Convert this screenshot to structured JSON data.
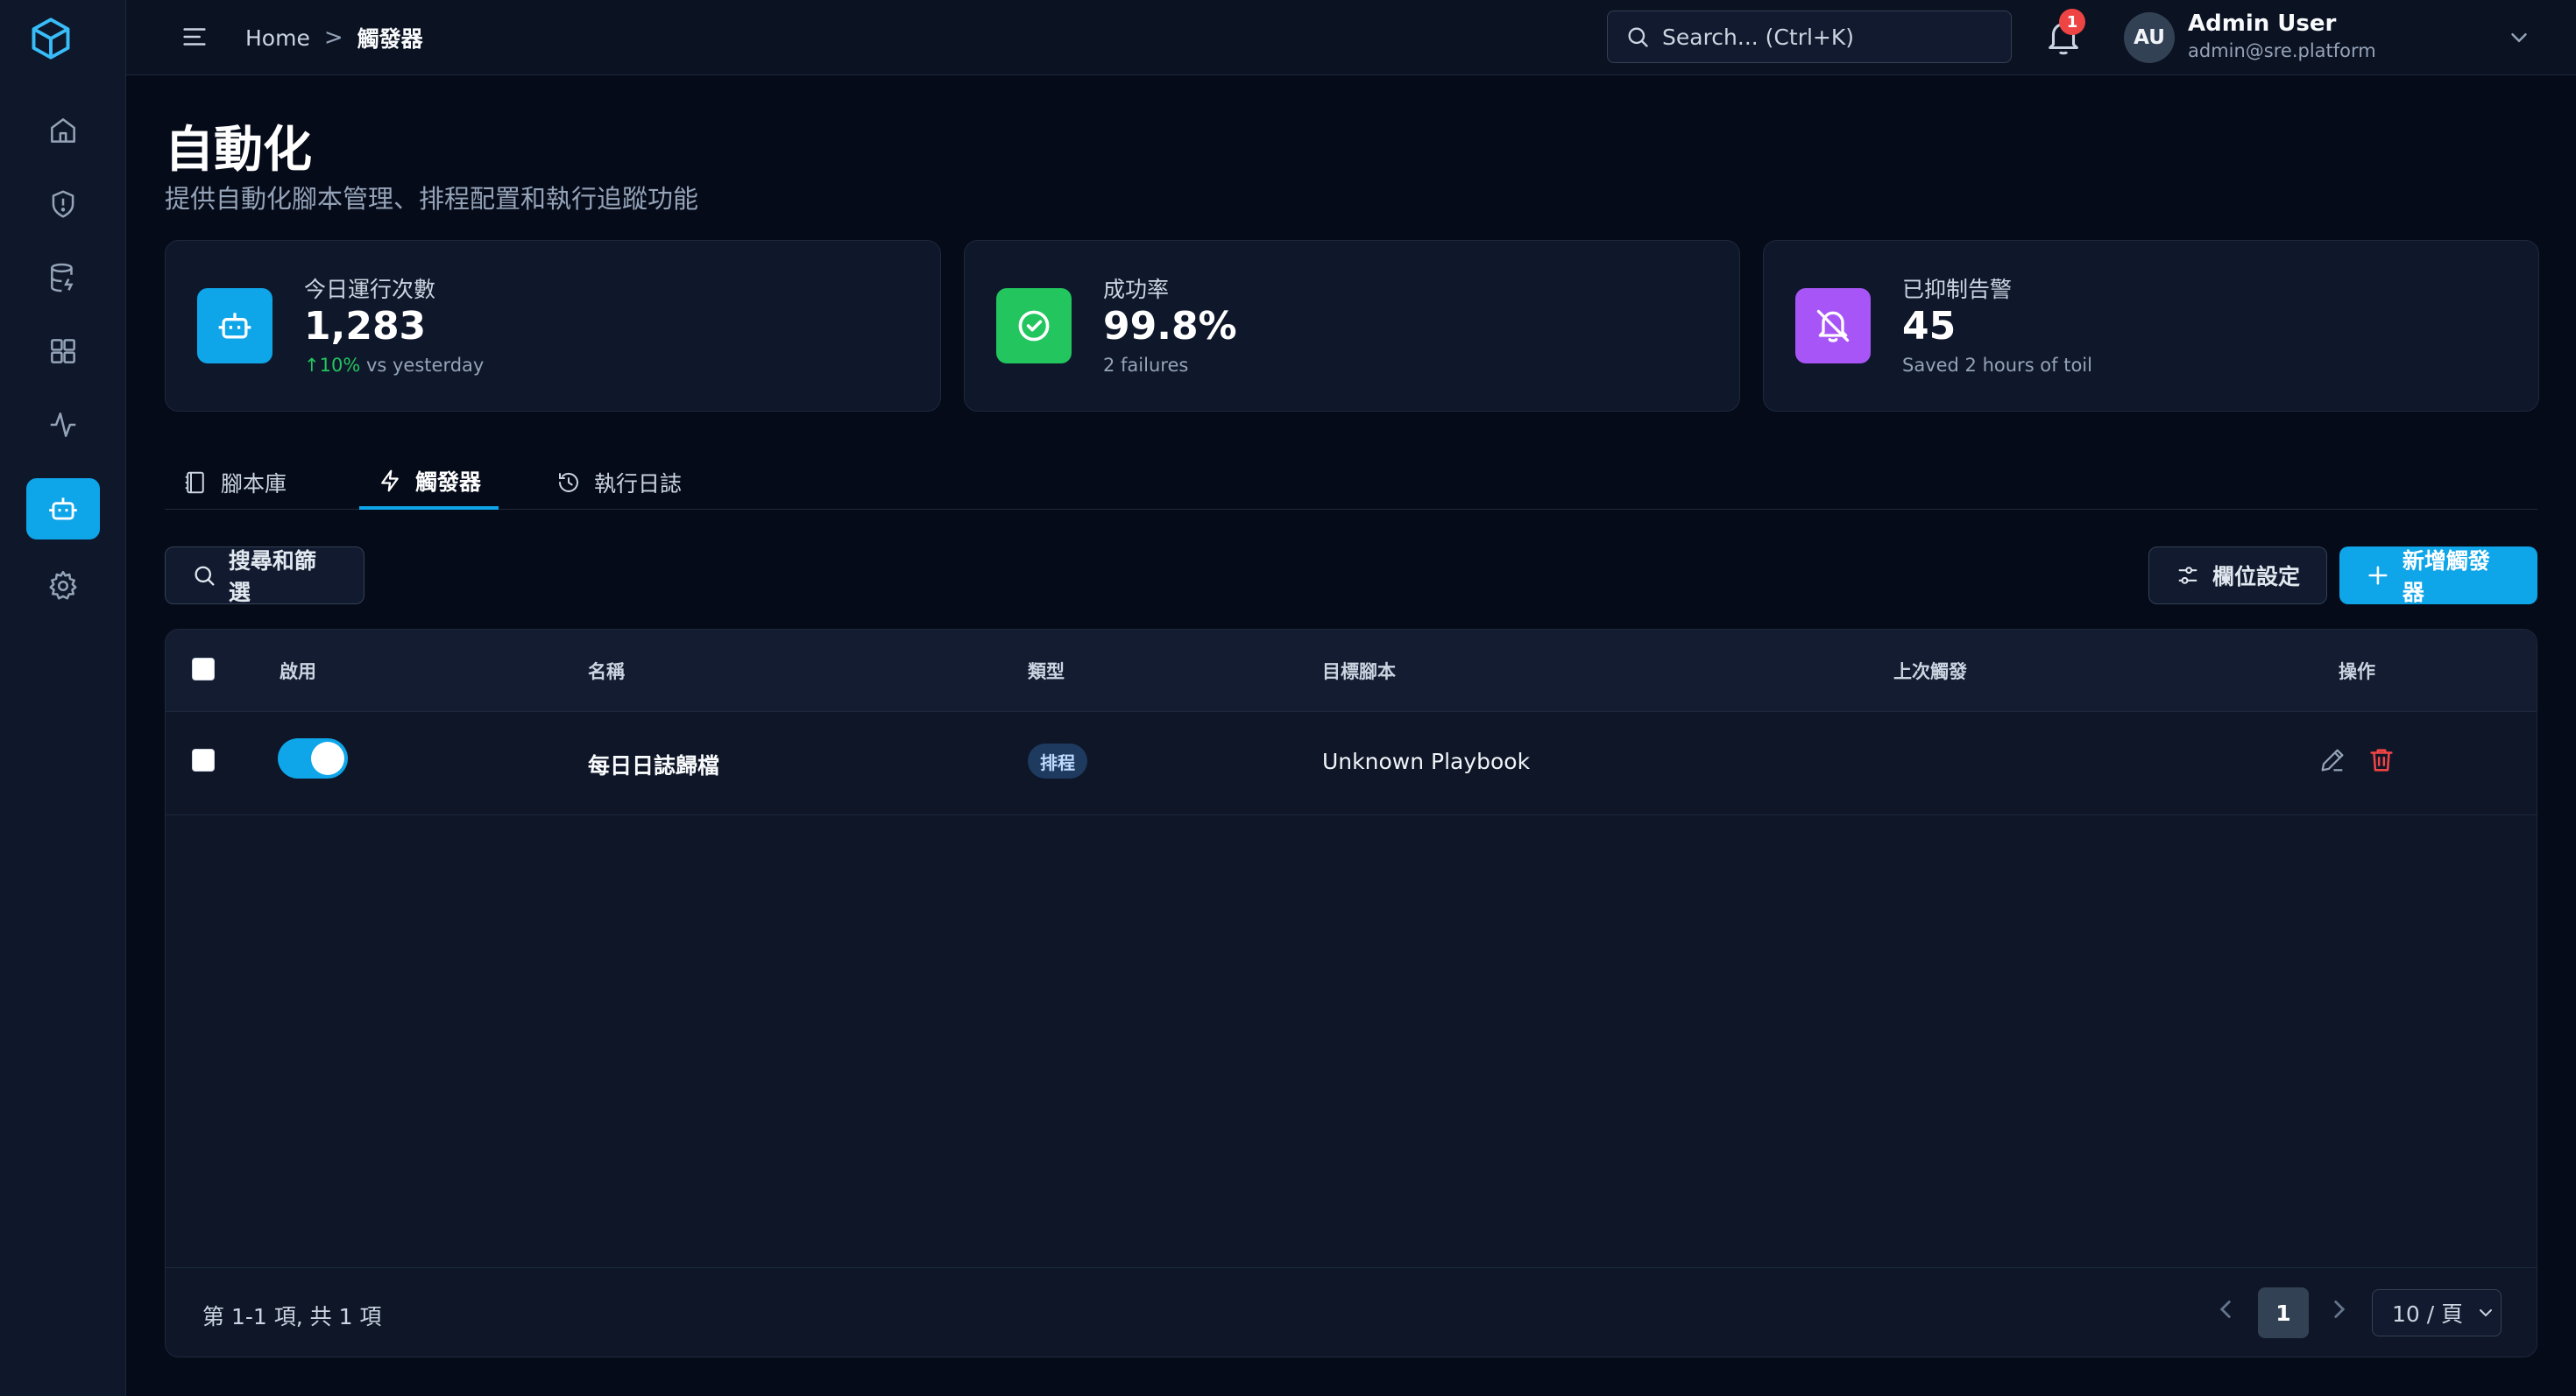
{
  "breadcrumb": {
    "home": "Home",
    "separator": ">",
    "current": "觸發器"
  },
  "search": {
    "placeholder": "Search... (Ctrl+K)"
  },
  "notifications": {
    "count": "1"
  },
  "user": {
    "initials": "AU",
    "name": "Admin User",
    "email": "admin@sre.platform"
  },
  "page": {
    "title": "自動化",
    "subtitle": "提供自動化腳本管理、排程配置和執行追蹤功能"
  },
  "stats": [
    {
      "label": "今日運行次數",
      "value": "1,283",
      "trend": "↑10%",
      "note": " vs yesterday",
      "color": "#0ea5e9",
      "icon": "robot-icon"
    },
    {
      "label": "成功率",
      "value": "99.8%",
      "note": "2 failures",
      "color": "#22c55e",
      "icon": "check-circle-icon"
    },
    {
      "label": "已抑制告警",
      "value": "45",
      "note": "Saved 2 hours of toil",
      "color": "#a855f7",
      "icon": "bell-off-icon"
    }
  ],
  "tabs": [
    {
      "label": "腳本庫",
      "icon": "book-icon"
    },
    {
      "label": "觸發器",
      "icon": "lightning-icon",
      "active": true
    },
    {
      "label": "執行日誌",
      "icon": "history-icon"
    }
  ],
  "toolbar": {
    "filter_label": "搜尋和篩選",
    "columns_label": "欄位設定",
    "add_label": "新增觸發器"
  },
  "table": {
    "columns": [
      "啟用",
      "名稱",
      "類型",
      "目標腳本",
      "上次觸發",
      "操作"
    ],
    "rows": [
      {
        "enabled": true,
        "name": "每日日誌歸檔",
        "type": "排程",
        "target": "Unknown Playbook",
        "last_triggered": ""
      }
    ]
  },
  "pagination": {
    "summary": "第 1-1 項, 共 1 項",
    "current_page": "1",
    "page_size": "10 / 頁"
  }
}
